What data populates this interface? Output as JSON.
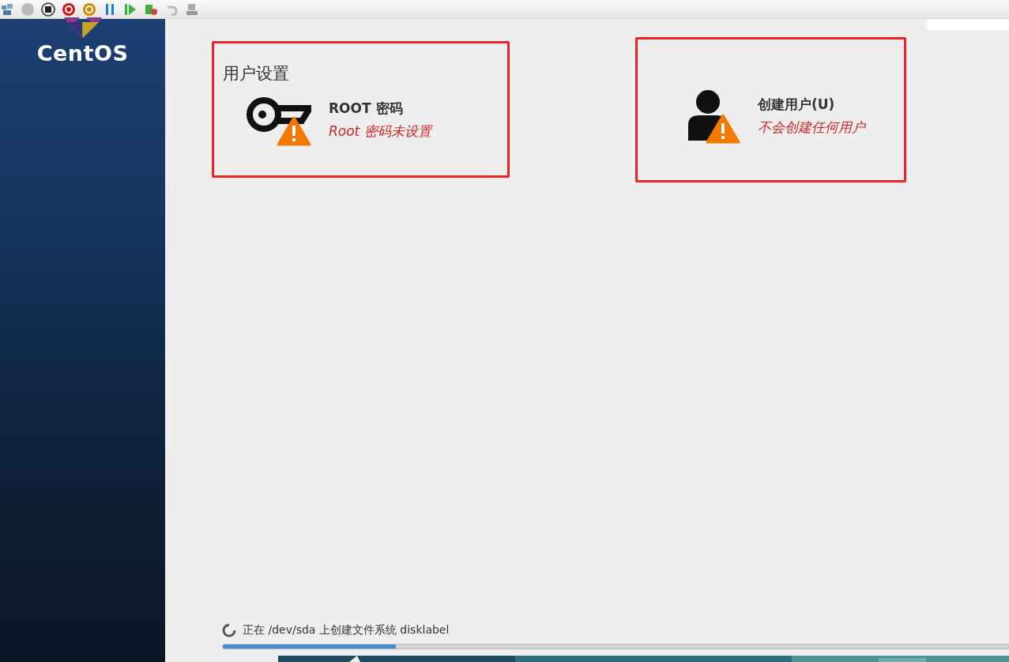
{
  "sidebar": {
    "logo_text": "CentOS"
  },
  "section_title": "用户设置",
  "spokes": [
    {
      "title": "ROOT 密码",
      "status": "Root 密码未设置",
      "kind": "key",
      "warning": true
    },
    {
      "title": "创建用户(U)",
      "status": "不会创建任何用户",
      "kind": "user",
      "warning": true
    }
  ],
  "progress": {
    "message": "正在 /dev/sda 上创建文件系统 disklabel",
    "level": 0.22
  }
}
